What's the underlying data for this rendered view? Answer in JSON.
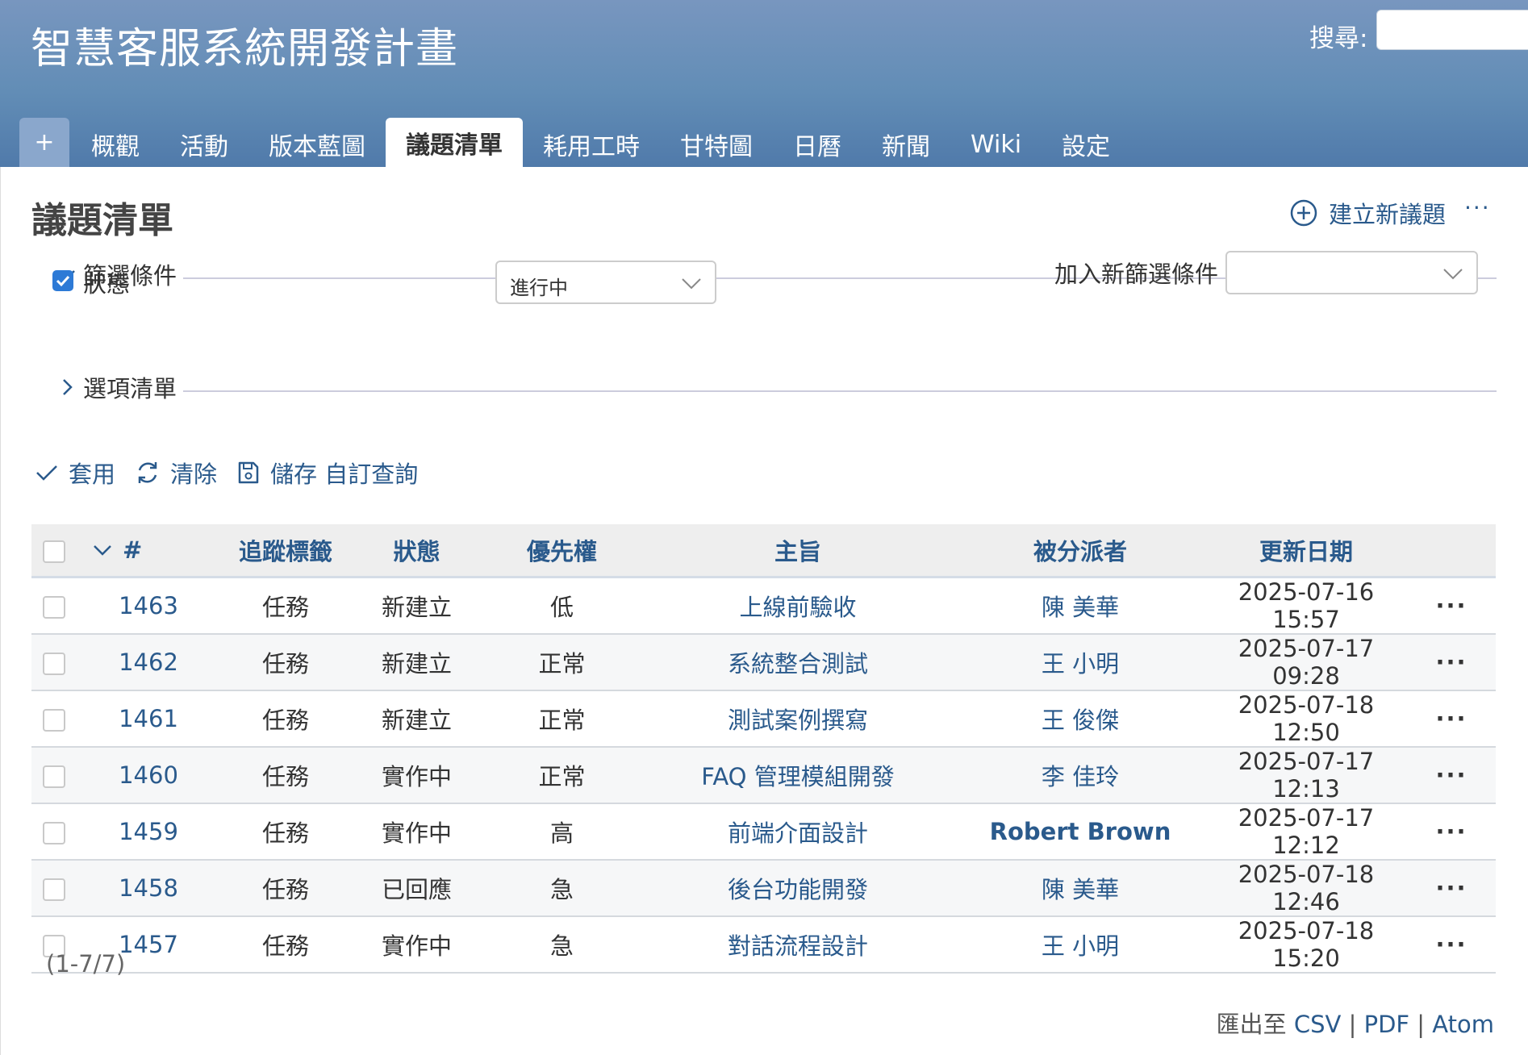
{
  "header": {
    "project_title": "智慧客服系統開發計畫",
    "search_label": "搜尋:",
    "search_value": ""
  },
  "menu": {
    "new_label": "+",
    "items": [
      {
        "label": "概觀"
      },
      {
        "label": "活動"
      },
      {
        "label": "版本藍圖"
      },
      {
        "label": "議題清單",
        "selected": true
      },
      {
        "label": "耗用工時"
      },
      {
        "label": "甘特圖"
      },
      {
        "label": "日曆"
      },
      {
        "label": "新聞"
      },
      {
        "label": "Wiki"
      },
      {
        "label": "設定"
      }
    ]
  },
  "page": {
    "title": "議題清單",
    "new_issue_label": "建立新議題",
    "more_actions_label": "···"
  },
  "filters": {
    "legend": "篩選條件",
    "status_label": "狀態",
    "status_checked": true,
    "status_value": "進行中",
    "add_filter_label": "加入新篩選條件",
    "add_filter_value": ""
  },
  "options": {
    "legend": "選項清單"
  },
  "query_buttons": {
    "apply": "套用",
    "clear": "清除",
    "save": "儲存 自訂查詢"
  },
  "table": {
    "columns": {
      "id": "#",
      "tracker": "追蹤標籤",
      "status": "狀態",
      "priority": "優先權",
      "subject": "主旨",
      "assignee": "被分派者",
      "updated": "更新日期"
    },
    "rows": [
      {
        "id": "1463",
        "tracker": "任務",
        "status": "新建立",
        "priority": "低",
        "subject": "上線前驗收",
        "assignee": "陳 美華",
        "updated": "2025-07-16 15:57",
        "menu": "···"
      },
      {
        "id": "1462",
        "tracker": "任務",
        "status": "新建立",
        "priority": "正常",
        "subject": "系統整合測試",
        "assignee": "王 小明",
        "updated": "2025-07-17 09:28",
        "menu": "···"
      },
      {
        "id": "1461",
        "tracker": "任務",
        "status": "新建立",
        "priority": "正常",
        "subject": "測試案例撰寫",
        "assignee": "王 俊傑",
        "updated": "2025-07-18 12:50",
        "menu": "···"
      },
      {
        "id": "1460",
        "tracker": "任務",
        "status": "實作中",
        "priority": "正常",
        "subject": "FAQ 管理模組開發",
        "assignee": "李 佳玲",
        "updated": "2025-07-17 12:13",
        "menu": "···"
      },
      {
        "id": "1459",
        "tracker": "任務",
        "status": "實作中",
        "priority": "高",
        "subject": "前端介面設計",
        "assignee": "Robert Brown",
        "updated": "2025-07-17 12:12",
        "menu": "···"
      },
      {
        "id": "1458",
        "tracker": "任務",
        "status": "已回應",
        "priority": "急",
        "subject": "後台功能開發",
        "assignee": "陳 美華",
        "updated": "2025-07-18 12:46",
        "menu": "···"
      },
      {
        "id": "1457",
        "tracker": "任務",
        "status": "實作中",
        "priority": "急",
        "subject": "對話流程設計",
        "assignee": "王 小明",
        "updated": "2025-07-18 15:20",
        "menu": "···"
      }
    ]
  },
  "pagination": "(1-7/7)",
  "export": {
    "prefix": "匯出至",
    "csv": "CSV",
    "pdf": "PDF",
    "atom": "Atom",
    "separator": "|"
  },
  "colors": {
    "header_top": "#7896bf",
    "header_bottom": "#507aaa",
    "link": "#2a5a8c",
    "checkbox_checked": "#2d7ad6"
  }
}
